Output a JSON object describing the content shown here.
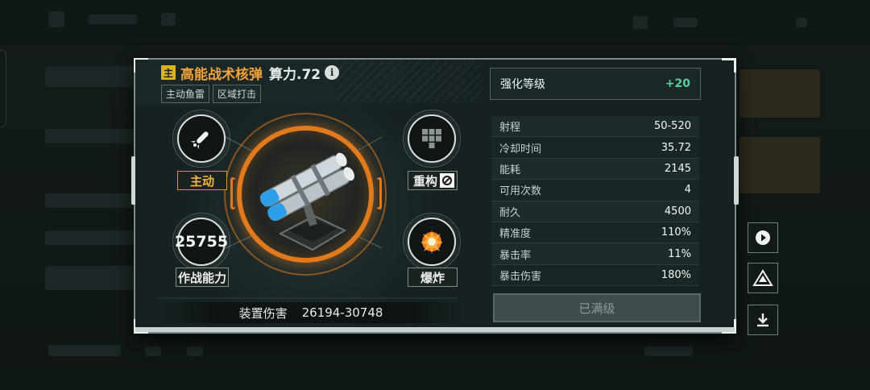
{
  "header": {
    "main_badge": "主",
    "weapon_name": "高能战术核弹",
    "power": "算力.72",
    "info_glyph": "i",
    "tags": [
      "主动鱼雷",
      "区域打击"
    ]
  },
  "enhance": {
    "label": "强化等级",
    "value": "+20"
  },
  "stats": [
    {
      "label": "射程",
      "value": "50-520"
    },
    {
      "label": "冷却时间",
      "value": "35.72"
    },
    {
      "label": "能耗",
      "value": "2145"
    },
    {
      "label": "可用次数",
      "value": "4"
    },
    {
      "label": "耐久",
      "value": "4500"
    },
    {
      "label": "精准度",
      "value": "110%"
    },
    {
      "label": "暴击率",
      "value": "11%"
    },
    {
      "label": "暴击伤害",
      "value": "180%"
    }
  ],
  "abilities": {
    "active_label": "主动",
    "rebuild_label": "重构",
    "combat_power_value": "25755",
    "combat_power_label": "作战能力",
    "explode_label": "爆炸"
  },
  "damage": {
    "label": "装置伤害",
    "value": "26194-30748"
  },
  "maxed_button": "已满级",
  "colors": {
    "accent_orange": "#e07a1c",
    "name_orange": "#f0a23c",
    "gold": "#f2b83a",
    "green": "#51d69a"
  },
  "icons": {
    "active": "missile-icon",
    "rebuild": "blocks-icon",
    "rebuild_badge": "no-symbol-icon",
    "explode": "explosion-icon",
    "side_buttons": [
      "play-icon",
      "fleet-icon",
      "download-icon"
    ]
  }
}
